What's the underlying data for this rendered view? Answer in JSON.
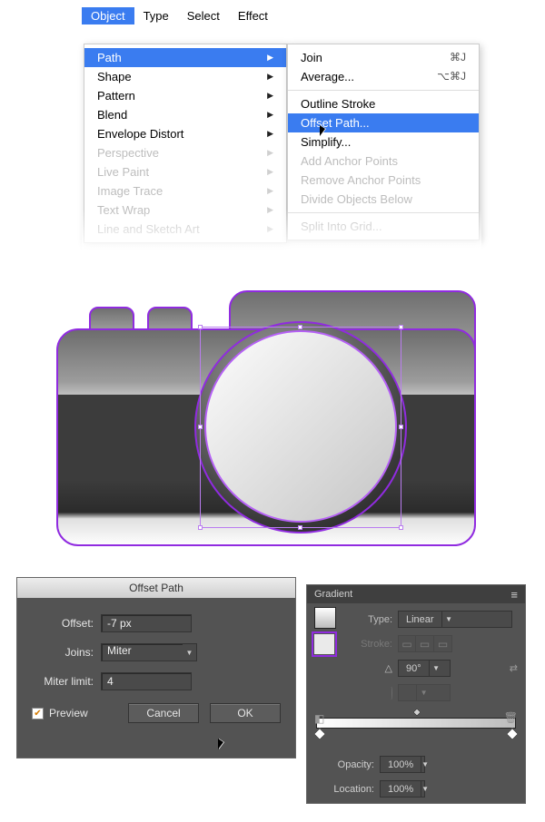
{
  "menubar": [
    "Object",
    "Type",
    "Select",
    "Effect"
  ],
  "dropdown": [
    {
      "label": "Path",
      "hl": true
    },
    {
      "label": "Shape"
    },
    {
      "label": "Pattern"
    },
    {
      "label": "Blend"
    },
    {
      "label": "Envelope Distort"
    },
    {
      "label": "Perspective",
      "disabled": true
    },
    {
      "label": "Live Paint",
      "disabled": true
    },
    {
      "label": "Image Trace",
      "disabled": true
    },
    {
      "label": "Text Wrap",
      "disabled": true
    },
    {
      "label": "Line and Sketch Art",
      "disabled": true
    }
  ],
  "submenu": [
    {
      "label": "Join",
      "shortcut": "⌘J"
    },
    {
      "label": "Average...",
      "shortcut": "⌥⌘J"
    },
    {
      "sep": true
    },
    {
      "label": "Outline Stroke"
    },
    {
      "label": "Offset Path...",
      "hl": true
    },
    {
      "label": "Simplify..."
    },
    {
      "label": "Add Anchor Points",
      "disabled": true
    },
    {
      "label": "Remove Anchor Points",
      "disabled": true
    },
    {
      "label": "Divide Objects Below",
      "disabled": true
    },
    {
      "sep": true
    },
    {
      "label": "Split Into Grid...",
      "disabled": true
    }
  ],
  "offset_dialog": {
    "title": "Offset Path",
    "offset_label": "Offset:",
    "offset_value": "-7 px",
    "joins_label": "Joins:",
    "joins_value": "Miter",
    "miter_label": "Miter limit:",
    "miter_value": "4",
    "preview_label": "Preview",
    "cancel": "Cancel",
    "ok": "OK"
  },
  "gradient_panel": {
    "title": "Gradient",
    "type_label": "Type:",
    "type_value": "Linear",
    "stroke_label": "Stroke:",
    "angle_value": "90°",
    "opacity_label": "Opacity:",
    "opacity_value": "100%",
    "location_label": "Location:",
    "location_value": "100%"
  }
}
